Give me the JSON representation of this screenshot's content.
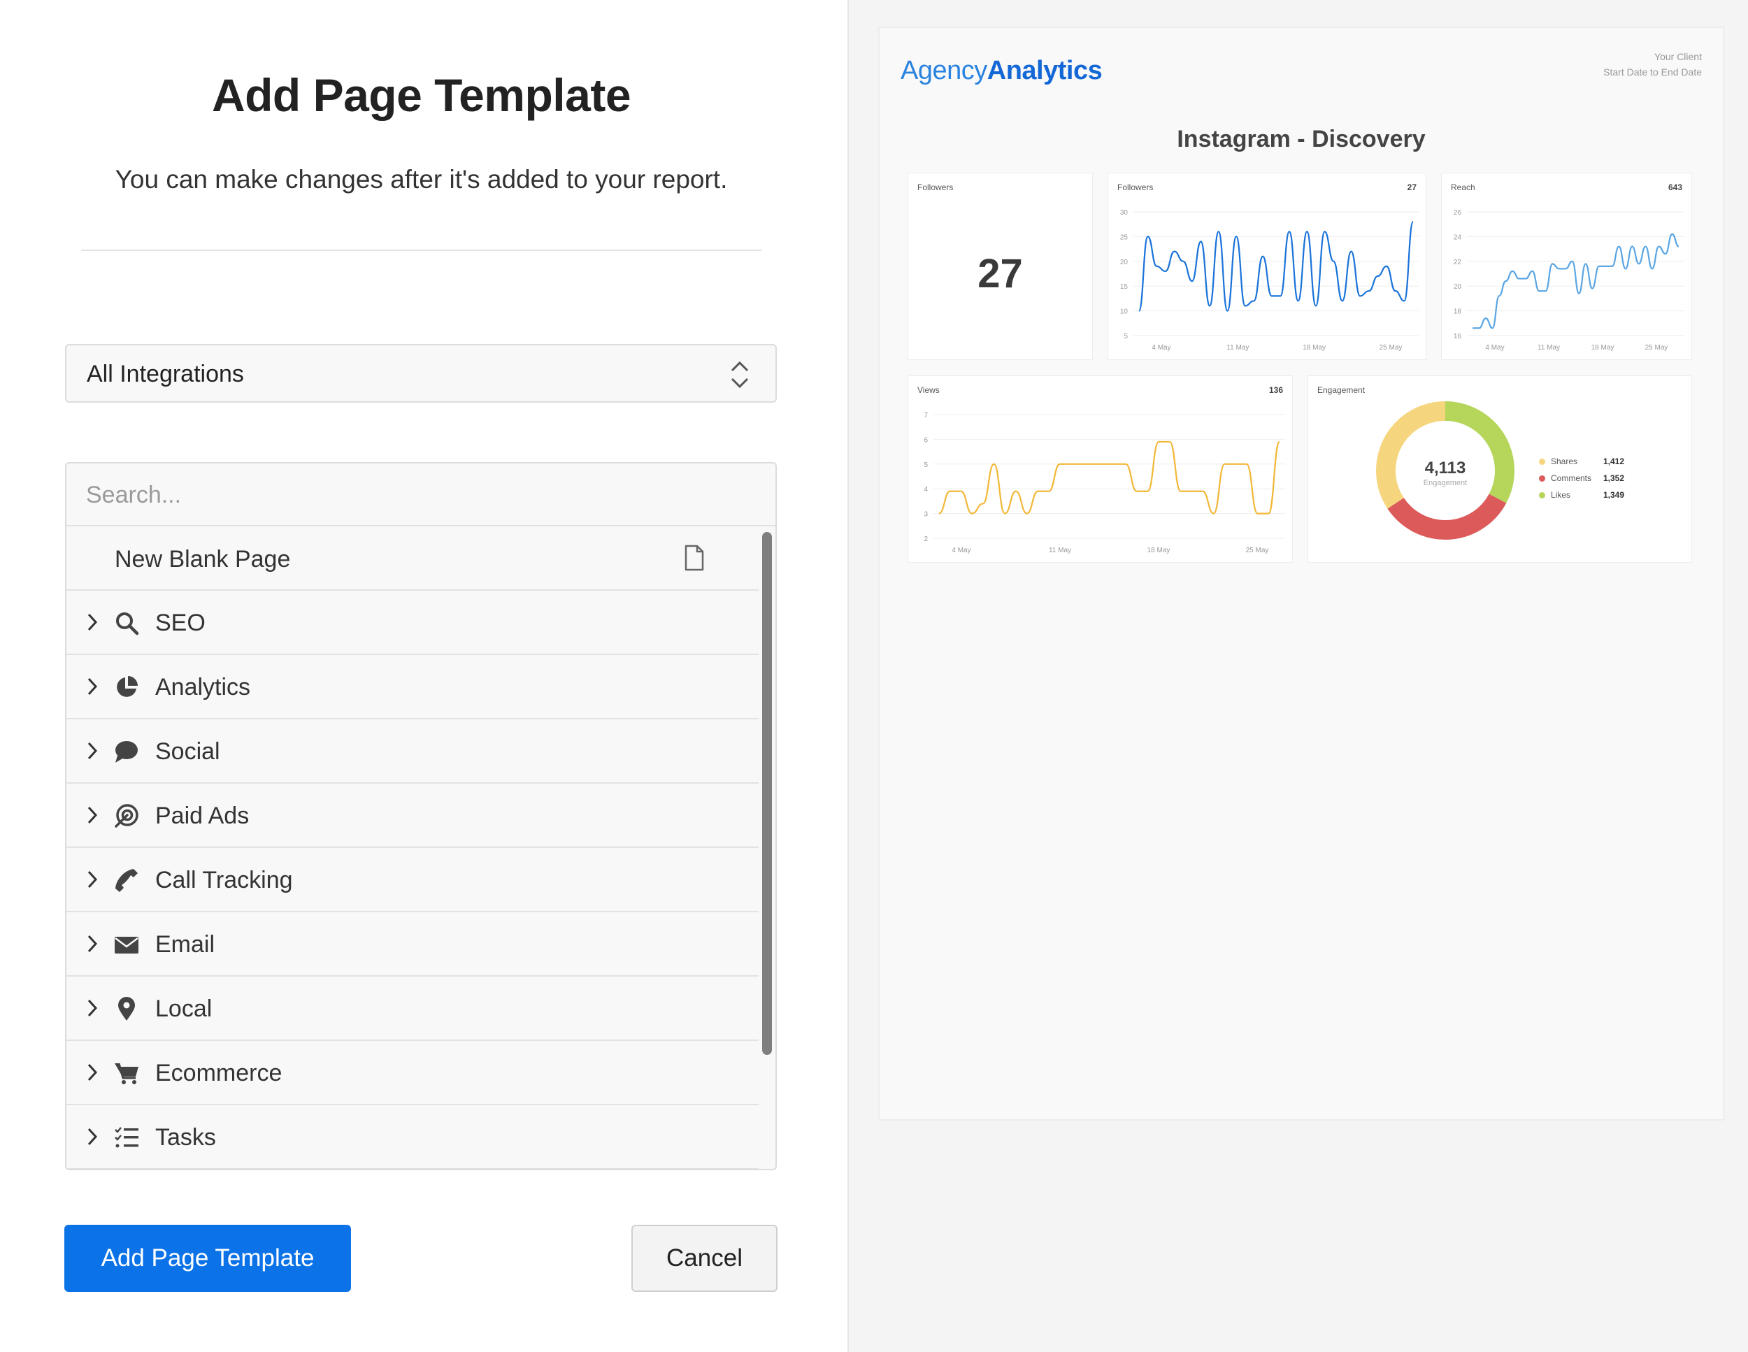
{
  "dialog": {
    "title": "Add Page Template",
    "subtitle": "You can make changes after it's added to your report.",
    "integrations_select": "All Integrations",
    "search_placeholder": "Search...",
    "new_blank_page": "New Blank Page",
    "categories": [
      {
        "label": "SEO",
        "icon": "search-icon"
      },
      {
        "label": "Analytics",
        "icon": "pie-chart-icon"
      },
      {
        "label": "Social",
        "icon": "chat-bubble-icon"
      },
      {
        "label": "Paid Ads",
        "icon": "target-icon"
      },
      {
        "label": "Call Tracking",
        "icon": "phone-icon"
      },
      {
        "label": "Email",
        "icon": "envelope-icon"
      },
      {
        "label": "Local",
        "icon": "map-pin-icon"
      },
      {
        "label": "Ecommerce",
        "icon": "cart-icon"
      },
      {
        "label": "Tasks",
        "icon": "tasks-icon"
      }
    ],
    "primary_button": "Add Page Template",
    "cancel_button": "Cancel",
    "primary_color": "#0b72e7"
  },
  "preview": {
    "logo_part1": "Agency",
    "logo_part2": "Analytics",
    "client": "Your Client",
    "date_range": "Start Date to End Date",
    "report_title": "Instagram - Discovery",
    "followers_card": {
      "title": "Followers",
      "value": "27"
    },
    "followers_chart": {
      "title": "Followers",
      "value": "27"
    },
    "reach_chart": {
      "title": "Reach",
      "value": "643"
    },
    "views_chart": {
      "title": "Views",
      "value": "136"
    },
    "engagement_card": {
      "title": "Engagement",
      "total": "4,113",
      "total_label": "Engagement",
      "legend": [
        {
          "name": "Shares",
          "value": "1,412",
          "color": "#f5d57e"
        },
        {
          "name": "Comments",
          "value": "1,352",
          "color": "#dc5a5a"
        },
        {
          "name": "Likes",
          "value": "1,349",
          "color": "#b5d65b"
        }
      ]
    }
  },
  "chart_data": [
    {
      "type": "line",
      "title": "Followers",
      "color": "#1a73d9",
      "ylim": [
        5,
        30
      ],
      "yticks": [
        "30",
        "25",
        "20",
        "15",
        "10",
        "5"
      ],
      "xticks": [
        "4 May",
        "11 May",
        "18 May",
        "25 May"
      ],
      "values": [
        10,
        25,
        19,
        18,
        22,
        20,
        16,
        24,
        11,
        26,
        10,
        25,
        11,
        12,
        21,
        13,
        13,
        26,
        12,
        26,
        11,
        26,
        20,
        12,
        22,
        13,
        14,
        17,
        19,
        14,
        12,
        28
      ]
    },
    {
      "type": "line",
      "title": "Reach",
      "color": "#5aa5e3",
      "ylim": [
        16,
        26
      ],
      "yticks": [
        "26",
        "24",
        "22",
        "20",
        "18",
        "16"
      ],
      "xticks": [
        "4 May",
        "11 May",
        "18 May",
        "25 May"
      ],
      "values": [
        16.6,
        16.6,
        17.4,
        16.6,
        19.2,
        20.4,
        21.2,
        20.6,
        20.6,
        21.2,
        19.6,
        19.6,
        21.8,
        21.4,
        21.4,
        22,
        19.4,
        21.8,
        19.8,
        21.6,
        21.6,
        21.6,
        23.2,
        21.4,
        23.2,
        21.8,
        23.2,
        21.4,
        23.2,
        22.6,
        24.2,
        23.2
      ]
    },
    {
      "type": "line",
      "title": "Views",
      "color": "#f2b737",
      "ylim": [
        2,
        7
      ],
      "yticks": [
        "7",
        "6",
        "5",
        "4",
        "3",
        "2"
      ],
      "xticks": [
        "4 May",
        "11 May",
        "18 May",
        "25 May"
      ],
      "values": [
        3,
        3.9,
        3.9,
        3,
        3.4,
        5,
        3,
        3.9,
        3,
        3.9,
        3.9,
        5,
        5,
        5,
        5,
        5,
        5,
        5,
        3.9,
        3.9,
        5.9,
        5.9,
        3.9,
        3.9,
        3.9,
        3,
        5,
        5,
        5,
        3,
        3,
        5.9
      ]
    },
    {
      "type": "pie",
      "title": "Engagement",
      "categories": [
        "Shares",
        "Comments",
        "Likes"
      ],
      "values": [
        1412,
        1352,
        1349
      ],
      "colors": [
        "#f5d57e",
        "#dc5a5a",
        "#b5d65b"
      ]
    }
  ]
}
